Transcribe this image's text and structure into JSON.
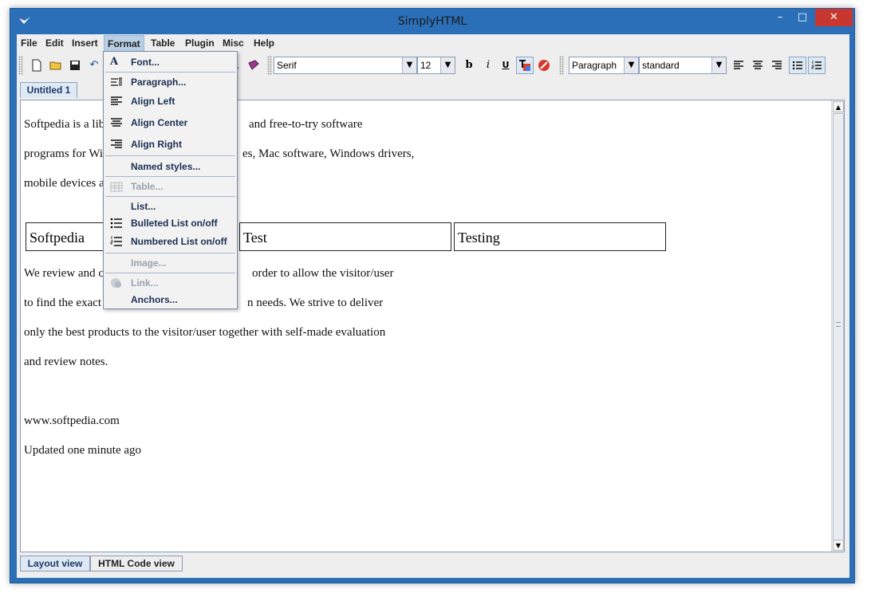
{
  "window": {
    "title": "SimplyHTML",
    "min_glyph": "–",
    "max_glyph": "□",
    "close_glyph": "✕"
  },
  "menubar": {
    "items": [
      "File",
      "Edit",
      "Insert",
      "Format",
      "Table",
      "Plugin",
      "Misc",
      "Help"
    ],
    "active": "Format"
  },
  "toolbar": {
    "font_family": "Serif",
    "font_size": "12",
    "bold_glyph": "b",
    "italic_glyph": "i",
    "underline_glyph": "U",
    "paragraph_style": "Paragraph",
    "named_style": "standard"
  },
  "tabs": {
    "document": "Untitled 1"
  },
  "document": {
    "lines": [
      "Softpedia is a libr",
      "and free-to-try software",
      "programs for Wi",
      "es, Mac software, Windows drivers,",
      "mobile devices a",
      "We review and c",
      "order to allow the visitor/user",
      "to find the exact p",
      "n needs. We strive to deliver",
      "only the best products to the visitor/user together with self-made evaluation",
      "and review notes.",
      "www.softpedia.com",
      "Updated one minute ago"
    ],
    "table": [
      "Softpedia",
      "Test",
      "Testing"
    ]
  },
  "format_menu": {
    "items": [
      {
        "label": "Font...",
        "icon": "font-icon",
        "disabled": false
      },
      {
        "label": "Paragraph...",
        "icon": "paragraph-icon",
        "disabled": false
      },
      {
        "label": "Align Left",
        "icon": "align-left-icon",
        "disabled": false
      },
      {
        "label": "Align Center",
        "icon": "align-center-icon",
        "disabled": false
      },
      {
        "label": "Align Right",
        "icon": "align-right-icon",
        "disabled": false
      },
      {
        "label": "Named styles...",
        "icon": "",
        "disabled": false
      },
      {
        "label": "Table...",
        "icon": "table-icon",
        "disabled": true
      },
      {
        "label": "List...",
        "icon": "",
        "disabled": false
      },
      {
        "label": "Bulleted List on/off",
        "icon": "bulleted-list-icon",
        "disabled": false
      },
      {
        "label": "Numbered List on/off",
        "icon": "numbered-list-icon",
        "disabled": false
      },
      {
        "label": "Image...",
        "icon": "",
        "disabled": true
      },
      {
        "label": "Link...",
        "icon": "link-icon",
        "disabled": true
      },
      {
        "label": "Anchors...",
        "icon": "",
        "disabled": false
      }
    ]
  },
  "view_tabs": {
    "layout": "Layout view",
    "html": "HTML Code view",
    "selected": "Layout view"
  },
  "colors": {
    "titlebar": "#2a6fb7",
    "close": "#c7372f",
    "menu_highlight": "#b8cfe5"
  }
}
